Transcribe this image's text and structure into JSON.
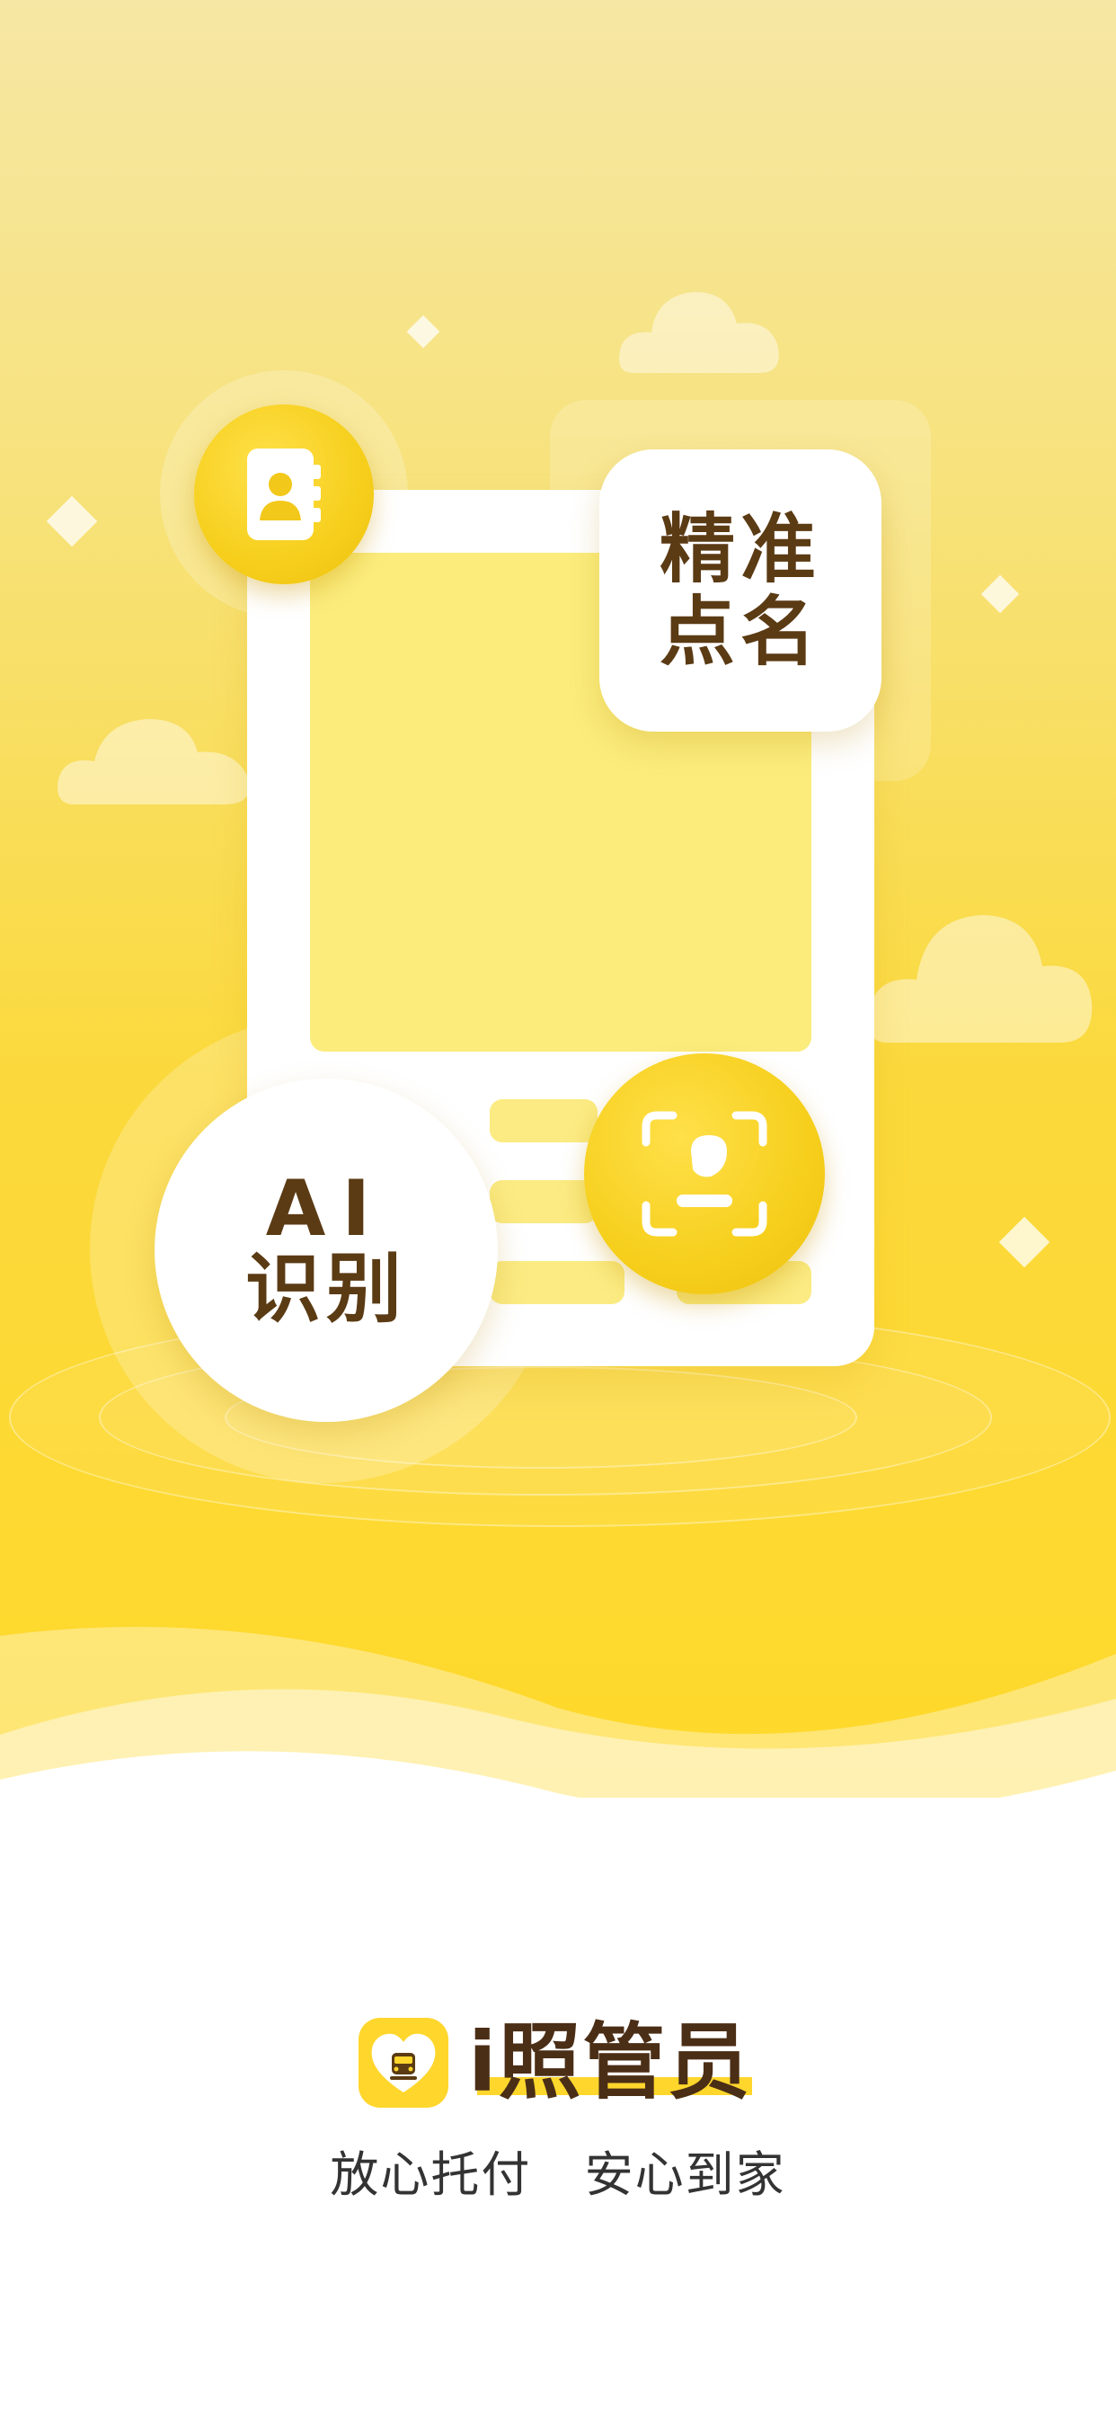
{
  "hero": {
    "card_precise": {
      "line1": "精准",
      "line2": "点名"
    },
    "card_ai": {
      "line1": "AI",
      "line2": "识别"
    },
    "icons": {
      "contact_book": "contact-book-icon",
      "face_scan": "face-scan-icon"
    }
  },
  "brand": {
    "name": "i照管员",
    "logo_icon": "heart-bus-logo-icon",
    "slogan_part1": "放心托付",
    "slogan_part2": "安心到家"
  },
  "colors": {
    "accent": "#ffd62c",
    "text_brown": "#5b3b14",
    "background_top": "#f6e7a4",
    "background_bottom": "#ffd92a"
  }
}
